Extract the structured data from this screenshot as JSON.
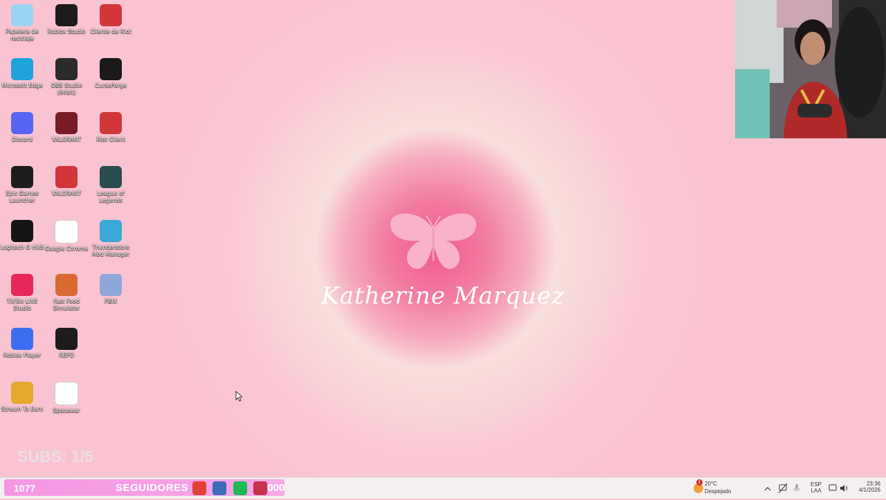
{
  "desktop_icons": [
    {
      "label": "Papelera de reciclaje",
      "icon": "recycle-bin-icon",
      "color": "#9bd4f0"
    },
    {
      "label": "Roblox Studio",
      "icon": "roblox-studio-icon",
      "color": "#1c1c1c"
    },
    {
      "label": "Cliente de Riot",
      "icon": "riot-client-icon",
      "color": "#d13639"
    },
    {
      "label": "Microsoft Edge",
      "icon": "edge-icon",
      "color": "#1fa3d8"
    },
    {
      "label": "OBS Studio (64bit)",
      "icon": "obs-icon",
      "color": "#2b2b2b"
    },
    {
      "label": "CurseForge",
      "icon": "curseforge-icon",
      "color": "#1a1a1a"
    },
    {
      "label": "Discord",
      "icon": "discord-icon",
      "color": "#5865f2"
    },
    {
      "label": "VALORANT",
      "icon": "valorant-icon",
      "color": "#7a1a24"
    },
    {
      "label": "Riot Client",
      "icon": "riot-client-icon",
      "color": "#d13639"
    },
    {
      "label": "Epic Games Launcher",
      "icon": "epic-games-icon",
      "color": "#1d1d1d"
    },
    {
      "label": "VALORANT",
      "icon": "riot-client-icon",
      "color": "#d13639"
    },
    {
      "label": "League of Legends",
      "icon": "league-icon",
      "color": "#2a4d4f"
    },
    {
      "label": "Logitech G HUB",
      "icon": "logitech-icon",
      "color": "#141414"
    },
    {
      "label": "Google Chrome",
      "icon": "chrome-icon",
      "color": "#ffffff"
    },
    {
      "label": "Thunderstore Mod Manager",
      "icon": "thunderstore-icon",
      "color": "#3aa8d8"
    },
    {
      "label": "TikTok LIVE Studio",
      "icon": "tiktok-live-icon",
      "color": "#e8285a"
    },
    {
      "label": "Fast Food Simulator",
      "icon": "game-icon",
      "color": "#d86b32"
    },
    {
      "label": "PBIX",
      "icon": "pbix-icon",
      "color": "#8fa6d8"
    },
    {
      "label": "Roblox Player",
      "icon": "roblox-player-icon",
      "color": "#3d6ef0"
    },
    {
      "label": "REPO",
      "icon": "repo-icon",
      "color": "#1c1c1c"
    },
    {
      "label": "Stream To Earn",
      "icon": "stream-to-earn-icon",
      "color": "#e3a82c"
    },
    {
      "label": "Spacewar",
      "icon": "file-icon",
      "color": "#ffffff"
    }
  ],
  "wallpaper": {
    "name": "Katherine Marquez",
    "butterfly_icon": "butterfly-icon",
    "accent": "#ef5a8a"
  },
  "overlay": {
    "subs_text": "SUBS: 1/5",
    "followers_count": "1077",
    "followers_label": "SEGUIDORES",
    "followers_goal": "2000",
    "followers_progress": 0.54
  },
  "taskbar": {
    "apps": [
      {
        "icon": "chrome-icon",
        "color": "#e44134"
      },
      {
        "icon": "store-icon",
        "color": "#3a6cb7"
      },
      {
        "icon": "spotify-icon",
        "color": "#1db954"
      },
      {
        "icon": "app-icon",
        "color": "#c8324a"
      }
    ],
    "weather_temp": "20°C",
    "weather_desc": "Despejado",
    "weather_badge": "1",
    "lang_top": "ESP",
    "lang_bottom": "LAA",
    "time": "23:36",
    "date": "4/1/2026"
  }
}
